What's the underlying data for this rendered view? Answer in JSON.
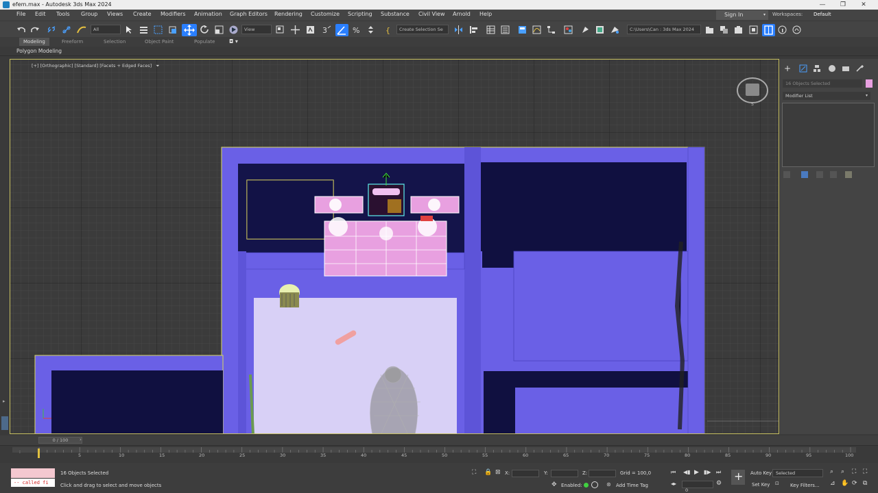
{
  "window": {
    "title": "efem.max - Autodesk 3ds Max 2024",
    "minimize": "—",
    "maximize": "❐",
    "close": "✕"
  },
  "menu": {
    "items": [
      "File",
      "Edit",
      "Tools",
      "Group",
      "Views",
      "Create",
      "Modifiers",
      "Animation",
      "Graph Editors",
      "Rendering",
      "Customize",
      "Scripting",
      "Substance",
      "Civil View",
      "Arnold",
      "Help"
    ],
    "sign_in": "Sign In",
    "workspaces_label": "Workspaces:",
    "workspace_value": "Default"
  },
  "toolbar": {
    "filter_value": "All",
    "refcoord_value": "View",
    "selection_set_placeholder": "Create Selection Se",
    "project_path": "C:\\Users\\Can : 3ds Max 2024"
  },
  "ribbon": {
    "tabs": [
      "Modeling",
      "Freeform",
      "Selection",
      "Object Paint",
      "Populate"
    ],
    "active_tab": "Modeling",
    "sub_label": "Polygon Modeling"
  },
  "viewport": {
    "label": "[+] [Orthographic] [Standard] [Facets + Edged Faces]",
    "filter_glyph": "⏷"
  },
  "command_panel": {
    "object_field": "16 Objects Selected",
    "modifier_list": "Modifier List"
  },
  "timeline": {
    "frame_display": "0 / 100",
    "ticks": [
      "5",
      "10",
      "15",
      "20",
      "25",
      "30",
      "35",
      "40",
      "45",
      "50",
      "55",
      "60",
      "65",
      "70",
      "75",
      "80",
      "85",
      "90",
      "95",
      "100"
    ]
  },
  "status": {
    "selection_count": "16 Objects Selected",
    "prompt": "Click and drag to select and move objects",
    "maxscript_text": "-- called fi",
    "x_label": "X:",
    "y_label": "Y:",
    "z_label": "Z:",
    "grid": "Grid = 100,0",
    "enabled_label": "Enabled:",
    "add_time_tag": "Add Time Tag",
    "auto_key": "Auto Key",
    "set_key": "Set Key",
    "key_mode": "Selected",
    "key_filters": "Key Filters...",
    "current_frame": "0"
  },
  "colors": {
    "accent_blue": "#2a7fff",
    "building": "#6a60e6",
    "dark_room": "#101040",
    "selection": "#e8e060"
  }
}
